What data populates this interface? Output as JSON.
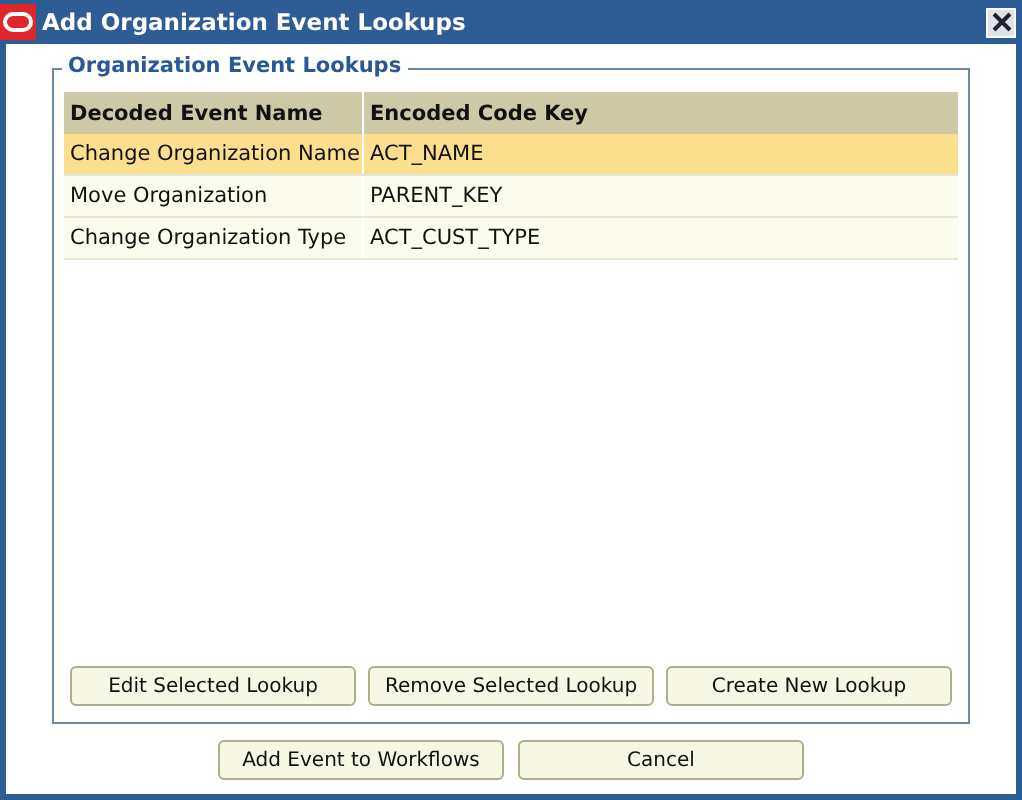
{
  "window": {
    "title": "Add Organization Event Lookups"
  },
  "group": {
    "title": "Organization Event Lookups"
  },
  "table": {
    "columns": [
      "Decoded Event Name",
      "Encoded Code Key"
    ],
    "rows": [
      {
        "cells": [
          "Change Organization Name",
          "ACT_NAME"
        ],
        "selected": true
      },
      {
        "cells": [
          "Move Organization",
          "PARENT_KEY"
        ],
        "selected": false
      },
      {
        "cells": [
          "Change Organization Type",
          "ACT_CUST_TYPE"
        ],
        "selected": false
      }
    ]
  },
  "group_buttons": [
    "Edit Selected Lookup",
    "Remove Selected Lookup",
    "Create New Lookup"
  ],
  "buttons": [
    "Add Event to Workflows",
    "Cancel"
  ]
}
